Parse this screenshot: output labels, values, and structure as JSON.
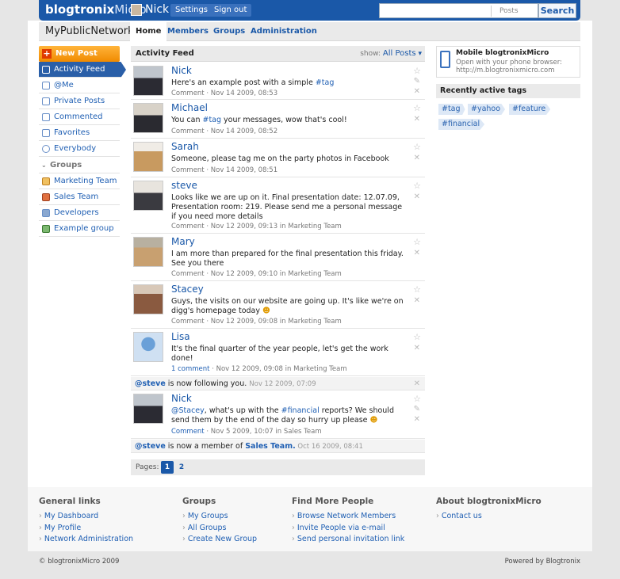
{
  "topbar": {
    "brand_bold": "blogtronix",
    "brand_rest": "Micro",
    "user_name": "Nick",
    "settings": "Settings",
    "signout": "Sign out",
    "search_placeholder": "",
    "search_scope": "Posts",
    "search_button": "Search"
  },
  "subnav": {
    "network_name": "MyPublicNetwork",
    "tabs": [
      "Home",
      "Members",
      "Groups",
      "Administration"
    ]
  },
  "sidebar": {
    "new_post": "New Post",
    "items": [
      "Activity Feed",
      "@Me",
      "Private Posts",
      "Commented",
      "Favorites",
      "Everybody"
    ],
    "groups_heading": "Groups",
    "groups": [
      "Marketing Team",
      "Sales Team",
      "Developers",
      "Example group"
    ]
  },
  "feed": {
    "title": "Activity Feed",
    "show_label": "show:",
    "show_value": "All Posts",
    "posts": [
      {
        "author": "Nick",
        "text_before": "Here's an example post with a simple ",
        "tag": "#tag",
        "text_after": "",
        "comment": "Comment",
        "date": " · Nov 14 2009, 08:53",
        "group": ""
      },
      {
        "author": "Michael",
        "text_before": "You can ",
        "tag": "#tag",
        "text_after": " your messages, wow that's cool!",
        "comment": "Comment",
        "date": " · Nov 14 2009, 08:52",
        "group": ""
      },
      {
        "author": "Sarah",
        "text_before": "Someone, please tag me on the party photos in Facebook",
        "tag": "",
        "text_after": "",
        "comment": "Comment",
        "date": " · Nov 14 2009, 08:51",
        "group": ""
      },
      {
        "author": "steve",
        "text_before": "Looks like we are up on it. Final presentation date: 12.07.09, Presentation room: 219. Please send me a personal message if you need more details",
        "tag": "",
        "text_after": "",
        "comment": "Comment",
        "date": " · Nov 12 2009, 09:13 in ",
        "group": "Marketing Team"
      },
      {
        "author": "Mary",
        "text_before": "I am more than prepared for the final presentation this friday. See you there",
        "tag": "",
        "text_after": "",
        "comment": "Comment",
        "date": " · Nov 12 2009, 09:10 in ",
        "group": "Marketing Team"
      },
      {
        "author": "Stacey",
        "text_before": "Guys, the visits on our website are going up. It's like we're on digg's homepage today ",
        "tag": "",
        "text_after": "",
        "comment": "Comment",
        "date": " · Nov 12 2009, 09:08 in ",
        "group": "Marketing Team"
      },
      {
        "author": "Lisa",
        "text_before": "It's the final quarter of the year people, let's get the work done!",
        "tag": "",
        "text_after": "",
        "comment": "1 comment",
        "date": " · Nov 12 2009, 09:08 in ",
        "group": "Marketing Team"
      },
      {
        "author": "Nick",
        "text_before": "",
        "mention": "@Stacey",
        "text_mid": ", what's up with the ",
        "tag": "#financial",
        "text_after": " reports? We should send them by the end of the day so hurry up please ",
        "comment": "Comment",
        "date": " · Nov 5 2009, 10:07 in ",
        "group": "Sales Team"
      }
    ],
    "notif1": {
      "user": "@steve",
      "text": " is now following you. ",
      "date": "Nov 12 2009, 07:09"
    },
    "notif2": {
      "user": "@steve",
      "text": " is now a member of ",
      "target": "Sales Team.",
      "date": " Oct 16 2009, 08:41"
    },
    "pages_label": "Pages:",
    "pages": [
      "1",
      "2"
    ]
  },
  "right": {
    "mobile_title": "Mobile blogtronixMicro",
    "mobile_sub1": "Open with your phone browser:",
    "mobile_sub2": "http://m.blogtronixmicro.com",
    "tags_heading": "Recently active tags",
    "tags": [
      "#tag",
      "#yahoo",
      "#feature",
      "#financial"
    ]
  },
  "footer": {
    "general": {
      "title": "General links",
      "links": [
        "My Dashboard",
        "My Profile",
        "Network Administration"
      ]
    },
    "groups": {
      "title": "Groups",
      "links": [
        "My Groups",
        "All Groups",
        "Create New Group"
      ]
    },
    "people": {
      "title": "Find More People",
      "links": [
        "Browse Network Members",
        "Invite People via e-mail",
        "Send personal invitation link"
      ]
    },
    "about": {
      "title": "About blogtronixMicro",
      "links": [
        "Contact us"
      ]
    },
    "copyright": "© blogtronixMicro 2009",
    "powered": "Powered by Blogtronix"
  },
  "colors": {
    "brand_blue": "#1a58a8",
    "accent_orange": "#f08a00"
  }
}
